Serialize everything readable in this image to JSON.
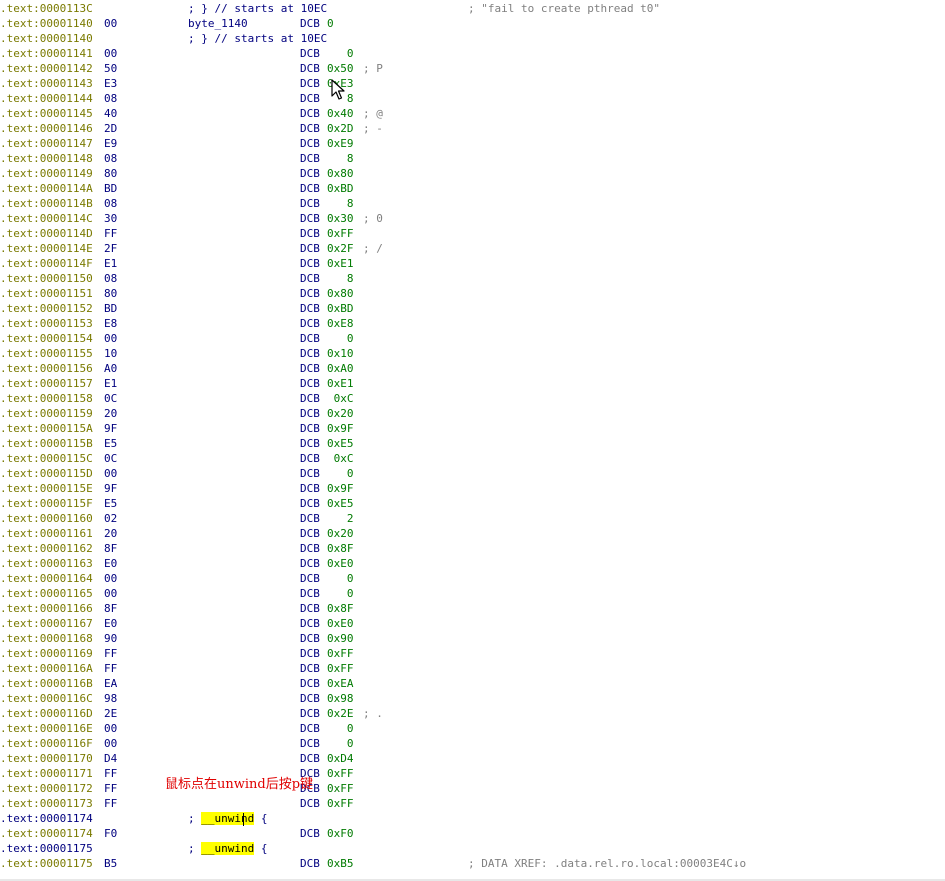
{
  "annotation": "鼠标点在unwind后按p键",
  "rows": [
    {
      "addr": ".text:0000113C",
      "hex": "",
      "label": "",
      "comment": "; } // starts at 10EC",
      "mnem": "",
      "ops": "",
      "inline": "",
      "right": "; \"fail to create pthread t0\""
    },
    {
      "addr": ".text:00001140",
      "hex": "00",
      "label": "byte_1140",
      "comment": "",
      "mnem": "DCB",
      "ops": "0",
      "inline": "",
      "right": ""
    },
    {
      "addr": ".text:00001140",
      "hex": "",
      "label": "",
      "comment": "; } // starts at 10EC",
      "mnem": "",
      "ops": "",
      "inline": "",
      "right": ""
    },
    {
      "addr": ".text:00001141",
      "hex": "00",
      "mnem": "DCB",
      "ops": "   0",
      "inline": ""
    },
    {
      "addr": ".text:00001142",
      "hex": "50",
      "mnem": "DCB",
      "ops": "0x50",
      "inline": "; P"
    },
    {
      "addr": ".text:00001143",
      "hex": "E3",
      "mnem": "DCB",
      "ops": "0xE3",
      "inline": ""
    },
    {
      "addr": ".text:00001144",
      "hex": "08",
      "mnem": "DCB",
      "ops": "   8",
      "inline": ""
    },
    {
      "addr": ".text:00001145",
      "hex": "40",
      "mnem": "DCB",
      "ops": "0x40",
      "inline": "; @"
    },
    {
      "addr": ".text:00001146",
      "hex": "2D",
      "mnem": "DCB",
      "ops": "0x2D",
      "inline": "; -"
    },
    {
      "addr": ".text:00001147",
      "hex": "E9",
      "mnem": "DCB",
      "ops": "0xE9",
      "inline": ""
    },
    {
      "addr": ".text:00001148",
      "hex": "08",
      "mnem": "DCB",
      "ops": "   8",
      "inline": ""
    },
    {
      "addr": ".text:00001149",
      "hex": "80",
      "mnem": "DCB",
      "ops": "0x80",
      "inline": ""
    },
    {
      "addr": ".text:0000114A",
      "hex": "BD",
      "mnem": "DCB",
      "ops": "0xBD",
      "inline": ""
    },
    {
      "addr": ".text:0000114B",
      "hex": "08",
      "mnem": "DCB",
      "ops": "   8",
      "inline": ""
    },
    {
      "addr": ".text:0000114C",
      "hex": "30",
      "mnem": "DCB",
      "ops": "0x30",
      "inline": "; 0"
    },
    {
      "addr": ".text:0000114D",
      "hex": "FF",
      "mnem": "DCB",
      "ops": "0xFF",
      "inline": ""
    },
    {
      "addr": ".text:0000114E",
      "hex": "2F",
      "mnem": "DCB",
      "ops": "0x2F",
      "inline": "; /"
    },
    {
      "addr": ".text:0000114F",
      "hex": "E1",
      "mnem": "DCB",
      "ops": "0xE1",
      "inline": ""
    },
    {
      "addr": ".text:00001150",
      "hex": "08",
      "mnem": "DCB",
      "ops": "   8",
      "inline": ""
    },
    {
      "addr": ".text:00001151",
      "hex": "80",
      "mnem": "DCB",
      "ops": "0x80",
      "inline": ""
    },
    {
      "addr": ".text:00001152",
      "hex": "BD",
      "mnem": "DCB",
      "ops": "0xBD",
      "inline": ""
    },
    {
      "addr": ".text:00001153",
      "hex": "E8",
      "mnem": "DCB",
      "ops": "0xE8",
      "inline": ""
    },
    {
      "addr": ".text:00001154",
      "hex": "00",
      "mnem": "DCB",
      "ops": "   0",
      "inline": ""
    },
    {
      "addr": ".text:00001155",
      "hex": "10",
      "mnem": "DCB",
      "ops": "0x10",
      "inline": ""
    },
    {
      "addr": ".text:00001156",
      "hex": "A0",
      "mnem": "DCB",
      "ops": "0xA0",
      "inline": ""
    },
    {
      "addr": ".text:00001157",
      "hex": "E1",
      "mnem": "DCB",
      "ops": "0xE1",
      "inline": ""
    },
    {
      "addr": ".text:00001158",
      "hex": "0C",
      "mnem": "DCB",
      "ops": " 0xC",
      "inline": ""
    },
    {
      "addr": ".text:00001159",
      "hex": "20",
      "mnem": "DCB",
      "ops": "0x20",
      "inline": ""
    },
    {
      "addr": ".text:0000115A",
      "hex": "9F",
      "mnem": "DCB",
      "ops": "0x9F",
      "inline": ""
    },
    {
      "addr": ".text:0000115B",
      "hex": "E5",
      "mnem": "DCB",
      "ops": "0xE5",
      "inline": ""
    },
    {
      "addr": ".text:0000115C",
      "hex": "0C",
      "mnem": "DCB",
      "ops": " 0xC",
      "inline": ""
    },
    {
      "addr": ".text:0000115D",
      "hex": "00",
      "mnem": "DCB",
      "ops": "   0",
      "inline": ""
    },
    {
      "addr": ".text:0000115E",
      "hex": "9F",
      "mnem": "DCB",
      "ops": "0x9F",
      "inline": ""
    },
    {
      "addr": ".text:0000115F",
      "hex": "E5",
      "mnem": "DCB",
      "ops": "0xE5",
      "inline": ""
    },
    {
      "addr": ".text:00001160",
      "hex": "02",
      "mnem": "DCB",
      "ops": "   2",
      "inline": ""
    },
    {
      "addr": ".text:00001161",
      "hex": "20",
      "mnem": "DCB",
      "ops": "0x20",
      "inline": ""
    },
    {
      "addr": ".text:00001162",
      "hex": "8F",
      "mnem": "DCB",
      "ops": "0x8F",
      "inline": ""
    },
    {
      "addr": ".text:00001163",
      "hex": "E0",
      "mnem": "DCB",
      "ops": "0xE0",
      "inline": ""
    },
    {
      "addr": ".text:00001164",
      "hex": "00",
      "mnem": "DCB",
      "ops": "   0",
      "inline": ""
    },
    {
      "addr": ".text:00001165",
      "hex": "00",
      "mnem": "DCB",
      "ops": "   0",
      "inline": ""
    },
    {
      "addr": ".text:00001166",
      "hex": "8F",
      "mnem": "DCB",
      "ops": "0x8F",
      "inline": ""
    },
    {
      "addr": ".text:00001167",
      "hex": "E0",
      "mnem": "DCB",
      "ops": "0xE0",
      "inline": ""
    },
    {
      "addr": ".text:00001168",
      "hex": "90",
      "mnem": "DCB",
      "ops": "0x90",
      "inline": ""
    },
    {
      "addr": ".text:00001169",
      "hex": "FF",
      "mnem": "DCB",
      "ops": "0xFF",
      "inline": ""
    },
    {
      "addr": ".text:0000116A",
      "hex": "FF",
      "mnem": "DCB",
      "ops": "0xFF",
      "inline": ""
    },
    {
      "addr": ".text:0000116B",
      "hex": "EA",
      "mnem": "DCB",
      "ops": "0xEA",
      "inline": ""
    },
    {
      "addr": ".text:0000116C",
      "hex": "98",
      "mnem": "DCB",
      "ops": "0x98",
      "inline": ""
    },
    {
      "addr": ".text:0000116D",
      "hex": "2E",
      "mnem": "DCB",
      "ops": "0x2E",
      "inline": "; ."
    },
    {
      "addr": ".text:0000116E",
      "hex": "00",
      "mnem": "DCB",
      "ops": "   0",
      "inline": ""
    },
    {
      "addr": ".text:0000116F",
      "hex": "00",
      "mnem": "DCB",
      "ops": "   0",
      "inline": ""
    },
    {
      "addr": ".text:00001170",
      "hex": "D4",
      "mnem": "DCB",
      "ops": "0xD4",
      "inline": ""
    },
    {
      "addr": ".text:00001171",
      "hex": "FF",
      "mnem": "DCB",
      "ops": "0xFF",
      "inline": ""
    },
    {
      "addr": ".text:00001172",
      "hex": "FF",
      "mnem": "DCB",
      "ops": "0xFF",
      "inline": ""
    },
    {
      "addr": ".text:00001173",
      "hex": "FF",
      "mnem": "DCB",
      "ops": "0xFF",
      "inline": ""
    },
    {
      "addr": ".text:00001174",
      "hex": "",
      "code": true,
      "unwind_prefix": "; ",
      "unwind_name": "__unwind",
      "unwind_suffix": " {",
      "mnem": "",
      "ops": "",
      "inline": ""
    },
    {
      "addr": ".text:00001174",
      "hex": "F0",
      "mnem": "DCB",
      "ops": "0xF0",
      "inline": ""
    },
    {
      "addr": ".text:00001175",
      "hex": "",
      "code": true,
      "unwind_prefix": "; ",
      "unwind_name": "__unwind",
      "unwind_suffix": " {",
      "mnem": "",
      "ops": "",
      "inline": ""
    },
    {
      "addr": ".text:00001175",
      "hex": "B5",
      "mnem": "DCB",
      "ops": "0xB5",
      "inline": "",
      "right": "; DATA XREF: .data.rel.ro.local:00003E4C↓o"
    }
  ]
}
